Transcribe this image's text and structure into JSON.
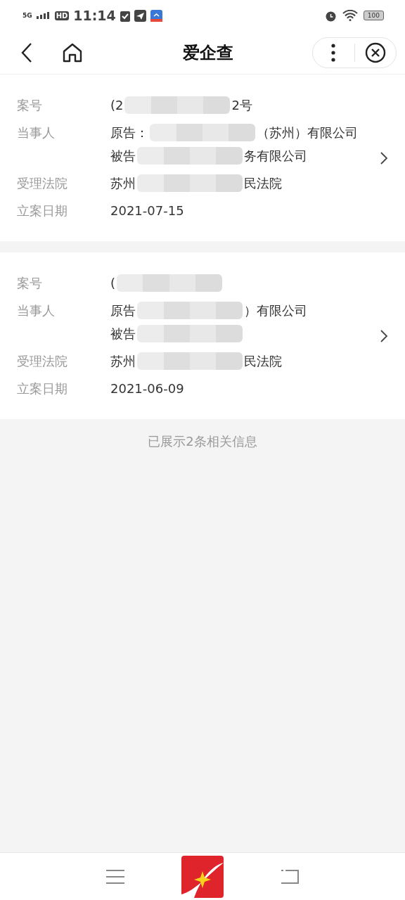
{
  "status_bar": {
    "network": "5G",
    "hd": "HD",
    "time": "11:14",
    "battery": "100"
  },
  "header": {
    "title": "爱企查"
  },
  "cases": [
    {
      "fields": [
        {
          "label": "案号",
          "lines": [
            [
              {
                "kind": "text",
                "text": "(2"
              },
              {
                "kind": "redacted"
              },
              {
                "kind": "text",
                "text": "2号"
              }
            ]
          ]
        },
        {
          "label": "当事人",
          "lines": [
            [
              {
                "kind": "text",
                "text": "原告："
              },
              {
                "kind": "redacted"
              },
              {
                "kind": "text",
                "text": "（苏州）有限公司"
              }
            ],
            [
              {
                "kind": "text",
                "text": "被告"
              },
              {
                "kind": "redacted"
              },
              {
                "kind": "text",
                "text": "务有限公司"
              }
            ]
          ]
        },
        {
          "label": "受理法院",
          "lines": [
            [
              {
                "kind": "text",
                "text": "苏州"
              },
              {
                "kind": "redacted"
              },
              {
                "kind": "text",
                "text": "民法院"
              }
            ]
          ]
        },
        {
          "label": "立案日期",
          "lines": [
            [
              {
                "kind": "text",
                "text": "2021-07-15"
              }
            ]
          ]
        }
      ]
    },
    {
      "fields": [
        {
          "label": "案号",
          "lines": [
            [
              {
                "kind": "text",
                "text": "("
              },
              {
                "kind": "redacted"
              }
            ]
          ]
        },
        {
          "label": "当事人",
          "lines": [
            [
              {
                "kind": "text",
                "text": "原告"
              },
              {
                "kind": "redacted"
              },
              {
                "kind": "text",
                "text": "）有限公司"
              }
            ],
            [
              {
                "kind": "text",
                "text": "被告"
              },
              {
                "kind": "redacted"
              }
            ]
          ]
        },
        {
          "label": "受理法院",
          "lines": [
            [
              {
                "kind": "text",
                "text": "苏州"
              },
              {
                "kind": "redacted"
              },
              {
                "kind": "text",
                "text": "民法院"
              }
            ]
          ]
        },
        {
          "label": "立案日期",
          "lines": [
            [
              {
                "kind": "text",
                "text": "2021-06-09"
              }
            ]
          ]
        }
      ]
    }
  ],
  "footer_note": "已展示2条相关信息"
}
